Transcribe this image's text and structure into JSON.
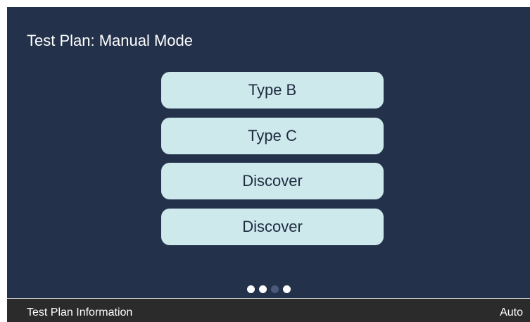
{
  "header": {
    "title": "Test Plan: Manual Mode"
  },
  "menu": {
    "items": [
      {
        "label": "Type B"
      },
      {
        "label": "Type C"
      },
      {
        "label": "Discover"
      },
      {
        "label": "Discover"
      }
    ]
  },
  "pager": {
    "total_pages": 4,
    "active_page": 3
  },
  "footer": {
    "left_label": "Test Plan Information",
    "right_label": "Auto"
  },
  "colors": {
    "background": "#23314b",
    "button_fill": "#cde9ec",
    "footer_bar": "#2b2b2b",
    "dot_inactive": "#ffffff",
    "dot_active": "#4a5a78"
  }
}
